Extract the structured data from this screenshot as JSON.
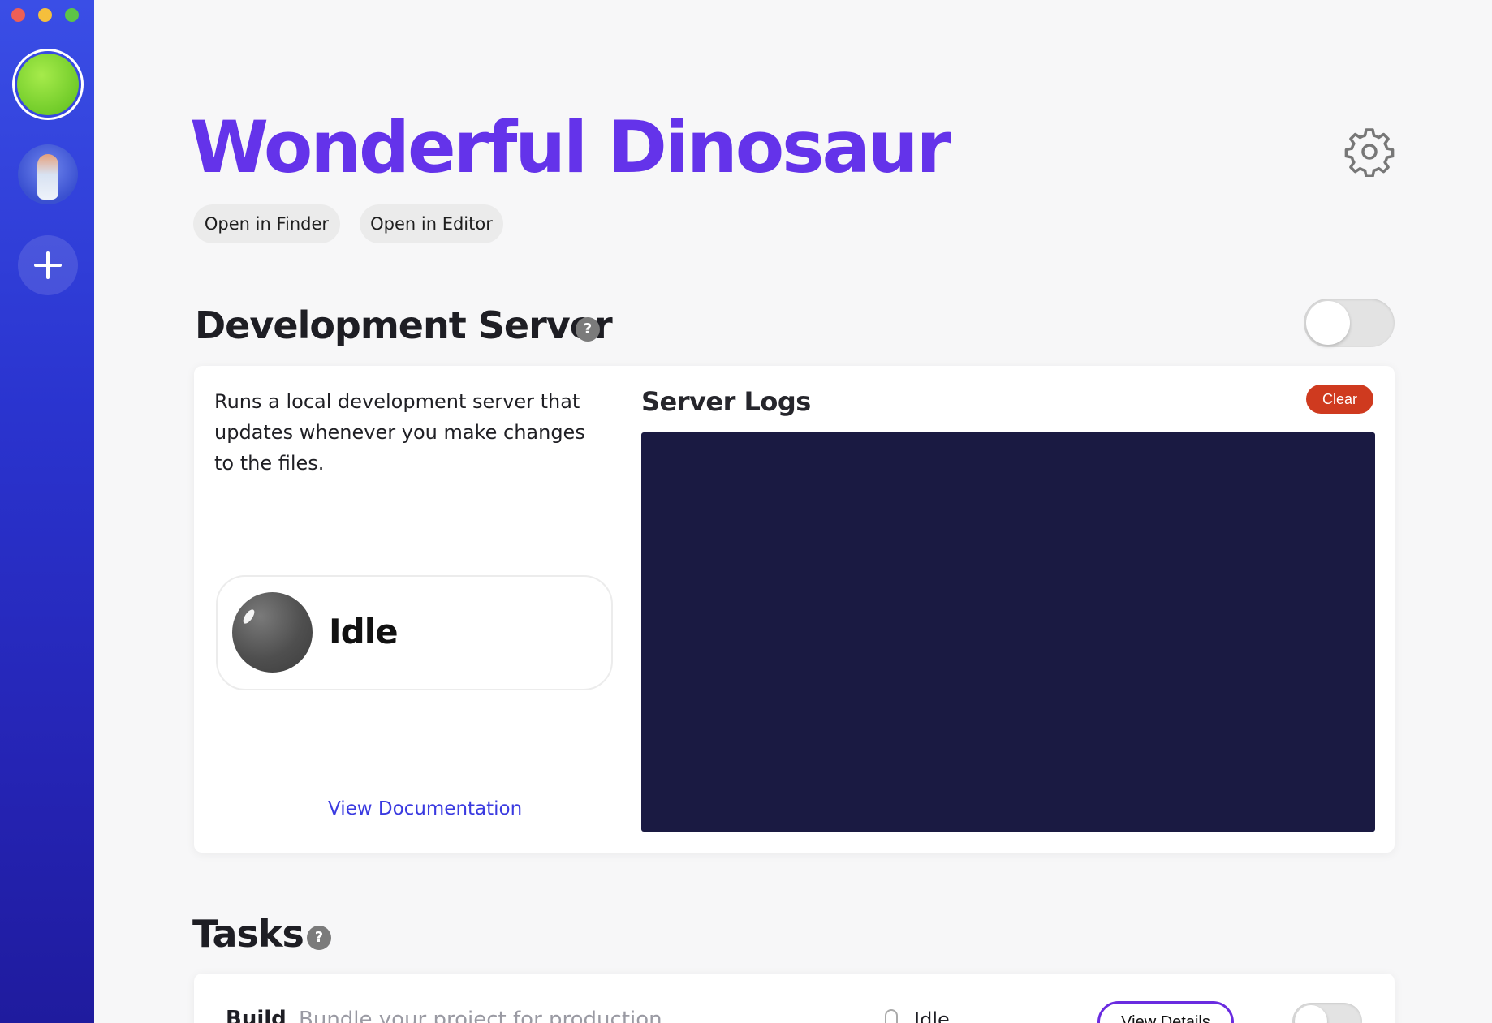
{
  "window": {
    "controls": [
      "close",
      "minimize",
      "zoom"
    ]
  },
  "sidebar": {
    "projects": [
      {
        "name": "Wonderful Dinosaur",
        "icon": "green-orb-avatar",
        "active": true
      },
      {
        "name": "",
        "icon": "pineapple-avatar",
        "active": false
      }
    ],
    "add_icon": "plus-icon"
  },
  "header": {
    "title": "Wonderful Dinosaur",
    "open_finder_label": "Open in Finder",
    "open_editor_label": "Open in Editor",
    "settings_icon": "gear-icon"
  },
  "dev_server": {
    "heading": "Development Server",
    "help_label": "?",
    "enabled": false,
    "description": "Runs a local development server that updates whenever you make changes to the files.",
    "status": "Idle",
    "doc_link": "View Documentation",
    "logs_heading": "Server Logs",
    "clear_label": "Clear",
    "logs": ""
  },
  "tasks": {
    "heading": "Tasks",
    "help_label": "?",
    "items": [
      {
        "name": "Build",
        "description": "Bundle your project for production",
        "status": "Idle",
        "details_label": "View Details",
        "enabled": false
      }
    ]
  },
  "colors": {
    "accent": "#6433ea",
    "sidebar_top": "#3a4ee6",
    "sidebar_bottom": "#1f1b9e",
    "logs_background": "#1a1a42",
    "clear_button": "#cf3a1f",
    "link": "#3a3ae0"
  }
}
